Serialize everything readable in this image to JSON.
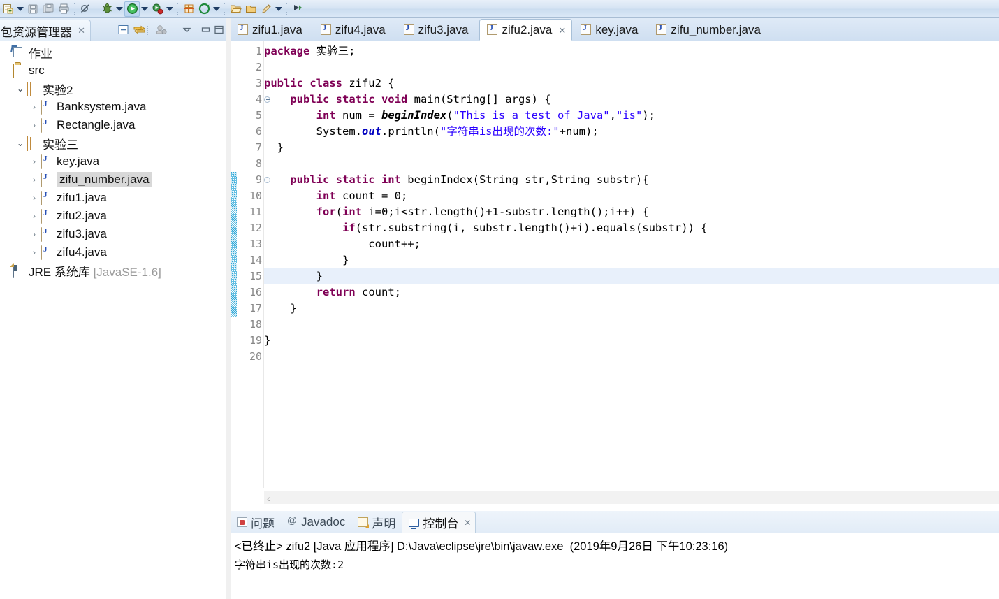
{
  "toolbar": {
    "groups": [
      {
        "items": [
          {
            "name": "new-wizard-icon",
            "glyph": "new"
          },
          {
            "name": "new-dropdown-arrow",
            "glyph": "arrow"
          },
          {
            "name": "save-icon",
            "glyph": "save"
          },
          {
            "name": "save-all-icon",
            "glyph": "saveall"
          },
          {
            "name": "print-icon",
            "glyph": "print"
          }
        ]
      },
      {
        "items": [
          {
            "name": "toggle-breakpoint-icon",
            "glyph": "nomark"
          }
        ]
      },
      {
        "items": [
          {
            "name": "debug-icon",
            "glyph": "debug"
          },
          {
            "name": "debug-dropdown-arrow",
            "glyph": "arrow"
          },
          {
            "name": "run-icon",
            "glyph": "run"
          },
          {
            "name": "run-dropdown-arrow",
            "glyph": "arrow"
          },
          {
            "name": "run-external-tools-icon",
            "glyph": "exttool"
          },
          {
            "name": "external-tools-dropdown-arrow",
            "glyph": "arrow"
          }
        ]
      },
      {
        "items": [
          {
            "name": "new-java-package-icon",
            "glyph": "pkgnew"
          },
          {
            "name": "new-java-class-icon",
            "glyph": "classnew"
          },
          {
            "name": "class-dropdown-arrow",
            "glyph": "arrow"
          }
        ]
      },
      {
        "items": [
          {
            "name": "open-type-icon",
            "glyph": "opentype"
          },
          {
            "name": "open-task-icon",
            "glyph": "opentask"
          },
          {
            "name": "search-icon",
            "glyph": "pencil"
          },
          {
            "name": "search-dropdown-arrow",
            "glyph": "arrow"
          }
        ]
      },
      {
        "items": [
          {
            "name": "next-annotation-icon",
            "glyph": "nextanno"
          }
        ]
      }
    ]
  },
  "left_panel": {
    "tab": {
      "label": "包资源管理器",
      "close": "✕"
    },
    "view_toolbar": [
      {
        "name": "collapse-all-icon",
        "glyph": "collapse"
      },
      {
        "name": "link-with-editor-icon",
        "glyph": "link"
      },
      {
        "name": "focus-on-active-task-icon",
        "glyph": "focus"
      },
      {
        "name": "view-menu-icon",
        "glyph": "menudown"
      },
      {
        "name": "minimize-view-icon",
        "glyph": "minimize"
      },
      {
        "name": "maximize-view-icon",
        "glyph": "maximize"
      }
    ],
    "tree": [
      {
        "label": "作业",
        "icon": "project-icon",
        "depth": 0,
        "chevron": "",
        "selected": false
      },
      {
        "label": "src",
        "icon": "source-folder-icon",
        "depth": 0,
        "chevron": "",
        "selected": false
      },
      {
        "label": "实验2",
        "icon": "package-icon",
        "depth": 1,
        "chevron": "open",
        "selected": false
      },
      {
        "label": "Banksystem.java",
        "icon": "java-file-icon",
        "depth": 2,
        "chevron": "closed",
        "selected": false
      },
      {
        "label": "Rectangle.java",
        "icon": "java-file-icon",
        "depth": 2,
        "chevron": "closed",
        "selected": false
      },
      {
        "label": "实验三",
        "icon": "package-icon",
        "depth": 1,
        "chevron": "open",
        "selected": false
      },
      {
        "label": "key.java",
        "icon": "java-file-icon",
        "depth": 2,
        "chevron": "closed",
        "selected": false
      },
      {
        "label": "zifu_number.java",
        "icon": "java-file-icon",
        "depth": 2,
        "chevron": "closed",
        "selected": true
      },
      {
        "label": "zifu1.java",
        "icon": "java-file-icon",
        "depth": 2,
        "chevron": "closed",
        "selected": false
      },
      {
        "label": "zifu2.java",
        "icon": "java-file-icon",
        "depth": 2,
        "chevron": "closed",
        "selected": false
      },
      {
        "label": "zifu3.java",
        "icon": "java-file-icon",
        "depth": 2,
        "chevron": "closed",
        "selected": false
      },
      {
        "label": "zifu4.java",
        "icon": "java-file-icon",
        "depth": 2,
        "chevron": "closed",
        "selected": false
      },
      {
        "label": "JRE 系统库",
        "suffix": "[JavaSE-1.6]",
        "icon": "jre-library-icon",
        "depth": 0,
        "chevron": "",
        "selected": false
      }
    ]
  },
  "editor": {
    "tabs": [
      {
        "label": "zifu1.java",
        "active": false
      },
      {
        "label": "zifu4.java",
        "active": false
      },
      {
        "label": "zifu3.java",
        "active": false
      },
      {
        "label": "zifu2.java",
        "active": true,
        "close": "✕"
      },
      {
        "label": "key.java",
        "active": false
      },
      {
        "label": "zifu_number.java",
        "active": false
      }
    ],
    "line_numbers": [
      1,
      2,
      3,
      4,
      5,
      6,
      7,
      8,
      9,
      10,
      11,
      12,
      13,
      14,
      15,
      16,
      17,
      18,
      19,
      20
    ],
    "fold_lines": [
      4,
      9
    ],
    "current_line": 15,
    "change_bar_lines": [
      9,
      10,
      11,
      12,
      13,
      14,
      15,
      16,
      17
    ],
    "code_lines": [
      {
        "n": 1,
        "tokens": [
          {
            "t": "package",
            "c": "kw"
          },
          {
            "t": " 实验三;",
            "c": "plain"
          }
        ]
      },
      {
        "n": 2,
        "tokens": []
      },
      {
        "n": 3,
        "tokens": [
          {
            "t": "public class",
            "c": "kw"
          },
          {
            "t": " zifu2 {",
            "c": "plain"
          }
        ]
      },
      {
        "n": 4,
        "tokens": [
          {
            "t": "    ",
            "c": "plain"
          },
          {
            "t": "public static void",
            "c": "kw"
          },
          {
            "t": " main(String[] args) {",
            "c": "plain"
          }
        ]
      },
      {
        "n": 5,
        "tokens": [
          {
            "t": "        ",
            "c": "plain"
          },
          {
            "t": "int",
            "c": "kw"
          },
          {
            "t": " num = ",
            "c": "plain"
          },
          {
            "t": "beginIndex",
            "c": "mth"
          },
          {
            "t": "(",
            "c": "plain"
          },
          {
            "t": "\"This is a test of Java\"",
            "c": "str"
          },
          {
            "t": ",",
            "c": "plain"
          },
          {
            "t": "\"is\"",
            "c": "str"
          },
          {
            "t": ");",
            "c": "plain"
          }
        ]
      },
      {
        "n": 6,
        "tokens": [
          {
            "t": "        ",
            "c": "plain"
          },
          {
            "t": "System.",
            "c": "plain"
          },
          {
            "t": "out",
            "c": "fld"
          },
          {
            "t": ".println(",
            "c": "plain"
          },
          {
            "t": "\"字符串is出现的次数:\"",
            "c": "str"
          },
          {
            "t": "+num);",
            "c": "plain"
          }
        ]
      },
      {
        "n": 7,
        "tokens": [
          {
            "t": "  }",
            "c": "plain"
          }
        ]
      },
      {
        "n": 8,
        "tokens": []
      },
      {
        "n": 9,
        "tokens": [
          {
            "t": "    ",
            "c": "plain"
          },
          {
            "t": "public static int",
            "c": "kw"
          },
          {
            "t": " beginIndex(String str,String substr){",
            "c": "plain"
          }
        ]
      },
      {
        "n": 10,
        "tokens": [
          {
            "t": "        ",
            "c": "plain"
          },
          {
            "t": "int",
            "c": "kw"
          },
          {
            "t": " count = ",
            "c": "plain"
          },
          {
            "t": "0",
            "c": "plain"
          },
          {
            "t": ";",
            "c": "plain"
          }
        ]
      },
      {
        "n": 11,
        "tokens": [
          {
            "t": "        ",
            "c": "plain"
          },
          {
            "t": "for",
            "c": "kw"
          },
          {
            "t": "(",
            "c": "plain"
          },
          {
            "t": "int",
            "c": "kw"
          },
          {
            "t": " i=0;i<str.length()+1-substr.length();i++) {",
            "c": "plain"
          }
        ]
      },
      {
        "n": 12,
        "tokens": [
          {
            "t": "            ",
            "c": "plain"
          },
          {
            "t": "if",
            "c": "kw"
          },
          {
            "t": "(str.substring(i, substr.length()+i).equals(substr)) {",
            "c": "plain"
          }
        ]
      },
      {
        "n": 13,
        "tokens": [
          {
            "t": "                count++;",
            "c": "plain"
          }
        ]
      },
      {
        "n": 14,
        "tokens": [
          {
            "t": "            }",
            "c": "plain"
          }
        ]
      },
      {
        "n": 15,
        "tokens": [
          {
            "t": "        }",
            "c": "plain"
          }
        ],
        "caret": true
      },
      {
        "n": 16,
        "tokens": [
          {
            "t": "        ",
            "c": "plain"
          },
          {
            "t": "return",
            "c": "kw"
          },
          {
            "t": " count;",
            "c": "plain"
          }
        ]
      },
      {
        "n": 17,
        "tokens": [
          {
            "t": "    }",
            "c": "plain"
          }
        ]
      },
      {
        "n": 18,
        "tokens": []
      },
      {
        "n": 19,
        "tokens": [
          {
            "t": "}",
            "c": "plain"
          }
        ]
      },
      {
        "n": 20,
        "tokens": []
      }
    ],
    "hscroll_left_arrow": "‹"
  },
  "bottom_panel": {
    "tabs": [
      {
        "label": "问题",
        "icon": "problems-icon",
        "active": false
      },
      {
        "label": "Javadoc",
        "icon": "javadoc-icon",
        "active": false
      },
      {
        "label": "声明",
        "icon": "declaration-icon",
        "active": false
      },
      {
        "label": "控制台",
        "icon": "console-icon",
        "active": true,
        "close": "✕"
      }
    ],
    "console": {
      "header": "<已终止> zifu2 [Java 应用程序] D:\\Java\\eclipse\\jre\\bin\\javaw.exe  (2019年9月26日 下午10:23:16)",
      "output": "字符串is出现的次数:2"
    }
  },
  "colors": {
    "keyword": "#7f0055",
    "string": "#2a00ff",
    "field": "#0000c0",
    "current_line": "#e8f0fb",
    "selection": "#d8d8d8",
    "changebar": "#2ea8d8"
  }
}
